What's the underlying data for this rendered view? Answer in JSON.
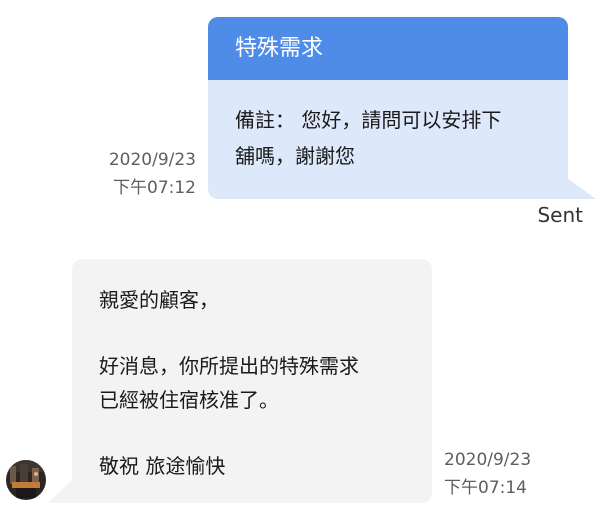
{
  "sent_message": {
    "title": "特殊需求",
    "body_line1": "備註： 您好，請問可以安排下",
    "body_line2": "舖嗎，謝謝您",
    "date": "2020/9/23",
    "time": "下午07:12",
    "status": "Sent"
  },
  "received_message": {
    "greeting": "親愛的顧客，",
    "line1": "好消息，你所提出的特殊需求",
    "line2": "已經被住宿核准了。",
    "closing": "敬祝 旅途愉快",
    "date": "2020/9/23",
    "time": "下午07:14"
  },
  "colors": {
    "header_blue": "#4e8ce8",
    "sent_bubble": "#dde9fb",
    "received_bubble": "#f3f3f3"
  }
}
